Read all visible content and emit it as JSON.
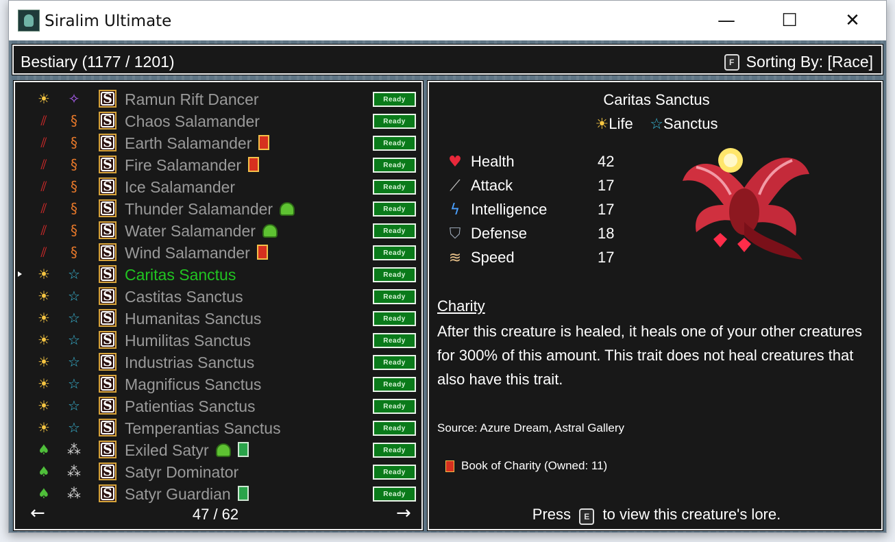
{
  "window": {
    "title": "Siralim Ultimate",
    "minimize": "—",
    "maximize": "☐",
    "close": "✕"
  },
  "header": {
    "title": "Bestiary (1177 / 1201)",
    "sort_key": "F",
    "sort_label": "Sorting By: [Race]"
  },
  "list": {
    "ready_label": "Ready",
    "page": "47 / 62",
    "prev": "←",
    "next": "→",
    "items": [
      {
        "name": "Ramun Rift Dancer",
        "icon1": "☀",
        "icon2": "✧",
        "badge": ""
      },
      {
        "name": "Chaos Salamander",
        "icon1": "⫽",
        "icon2": "§",
        "badge": ""
      },
      {
        "name": "Earth Salamander",
        "icon1": "⫽",
        "icon2": "§",
        "badge": "book-red"
      },
      {
        "name": "Fire Salamander",
        "icon1": "⫽",
        "icon2": "§",
        "badge": "book-red"
      },
      {
        "name": "Ice Salamander",
        "icon1": "⫽",
        "icon2": "§",
        "badge": ""
      },
      {
        "name": "Thunder Salamander",
        "icon1": "⫽",
        "icon2": "§",
        "badge": "slime"
      },
      {
        "name": "Water Salamander",
        "icon1": "⫽",
        "icon2": "§",
        "badge": "slime"
      },
      {
        "name": "Wind Salamander",
        "icon1": "⫽",
        "icon2": "§",
        "badge": "book-red"
      },
      {
        "name": "Caritas Sanctus",
        "icon1": "☀",
        "icon2": "☆",
        "badge": "",
        "selected": true
      },
      {
        "name": "Castitas Sanctus",
        "icon1": "☀",
        "icon2": "☆",
        "badge": ""
      },
      {
        "name": "Humanitas Sanctus",
        "icon1": "☀",
        "icon2": "☆",
        "badge": ""
      },
      {
        "name": "Humilitas Sanctus",
        "icon1": "☀",
        "icon2": "☆",
        "badge": ""
      },
      {
        "name": "Industrias Sanctus",
        "icon1": "☀",
        "icon2": "☆",
        "badge": ""
      },
      {
        "name": "Magnificus Sanctus",
        "icon1": "☀",
        "icon2": "☆",
        "badge": ""
      },
      {
        "name": "Patientias Sanctus",
        "icon1": "☀",
        "icon2": "☆",
        "badge": ""
      },
      {
        "name": "Temperantias Sanctus",
        "icon1": "☀",
        "icon2": "☆",
        "badge": ""
      },
      {
        "name": "Exiled Satyr",
        "icon1": "♠",
        "icon2": "⁂",
        "badge": "slime",
        "badge2": "book-green"
      },
      {
        "name": "Satyr Dominator",
        "icon1": "♠",
        "icon2": "⁂",
        "badge": ""
      },
      {
        "name": "Satyr Guardian",
        "icon1": "♠",
        "icon2": "⁂",
        "badge": "book-green"
      }
    ]
  },
  "detail": {
    "name": "Caritas Sanctus",
    "class_icon": "☀",
    "class": "Life",
    "race_icon": "☆",
    "race": "Sanctus",
    "stats": [
      {
        "label": "Health",
        "value": "42",
        "icon": "heart-icon",
        "glyph": "♥",
        "color": "#e8283a"
      },
      {
        "label": "Attack",
        "value": "17",
        "icon": "sword-icon",
        "glyph": "⟋",
        "color": "#c9c9c9"
      },
      {
        "label": "Intelligence",
        "value": "17",
        "icon": "lightning-icon",
        "glyph": "ϟ",
        "color": "#4aa0ff"
      },
      {
        "label": "Defense",
        "value": "18",
        "icon": "shield-icon",
        "glyph": "⛉",
        "color": "#9aa6b4"
      },
      {
        "label": "Speed",
        "value": "17",
        "icon": "wing-icon",
        "glyph": "≋",
        "color": "#e7c089"
      }
    ],
    "trait_name": "Charity",
    "trait_desc": "After this creature is healed, it heals one of your other creatures for 300% of this amount. This trait does not heal creatures that also have this trait.",
    "source": "Source: Azure Dream, Astral Gallery",
    "book": "Book of Charity (Owned: 11)",
    "lore_press": "Press",
    "lore_key": "E",
    "lore_text": "to view this creature's lore."
  },
  "colors": {
    "selected": "#21c421",
    "ready_bg": "#0a7a1a",
    "panel_bg": "#181818"
  }
}
